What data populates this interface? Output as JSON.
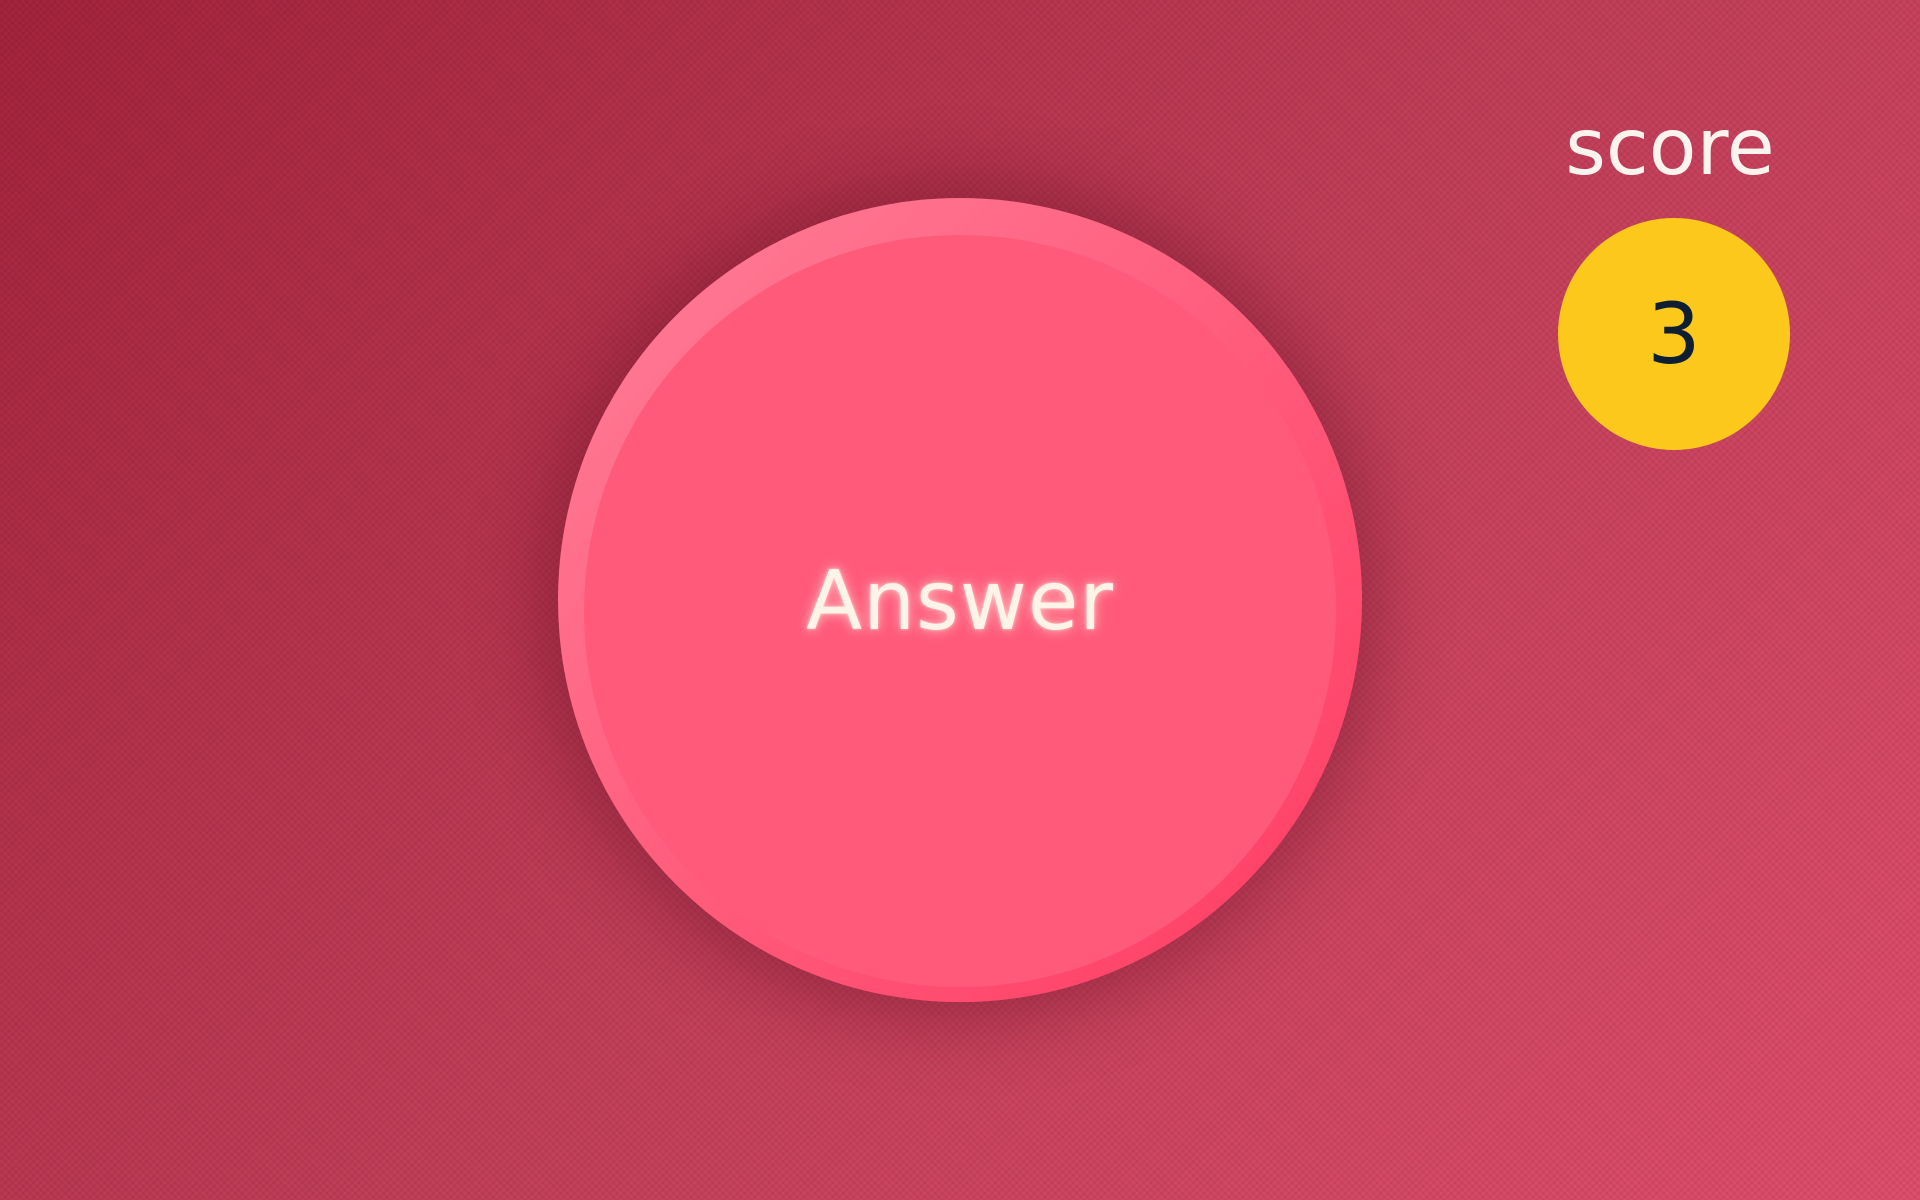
{
  "game": {
    "answer_label": "Answer",
    "score_label": "score",
    "score_value": "3"
  },
  "colors": {
    "background": "#b8324f",
    "button": "#ff5a79",
    "score_badge": "#fcc81c",
    "score_text": "#0e1e33",
    "label_text": "#fbf4ee"
  }
}
